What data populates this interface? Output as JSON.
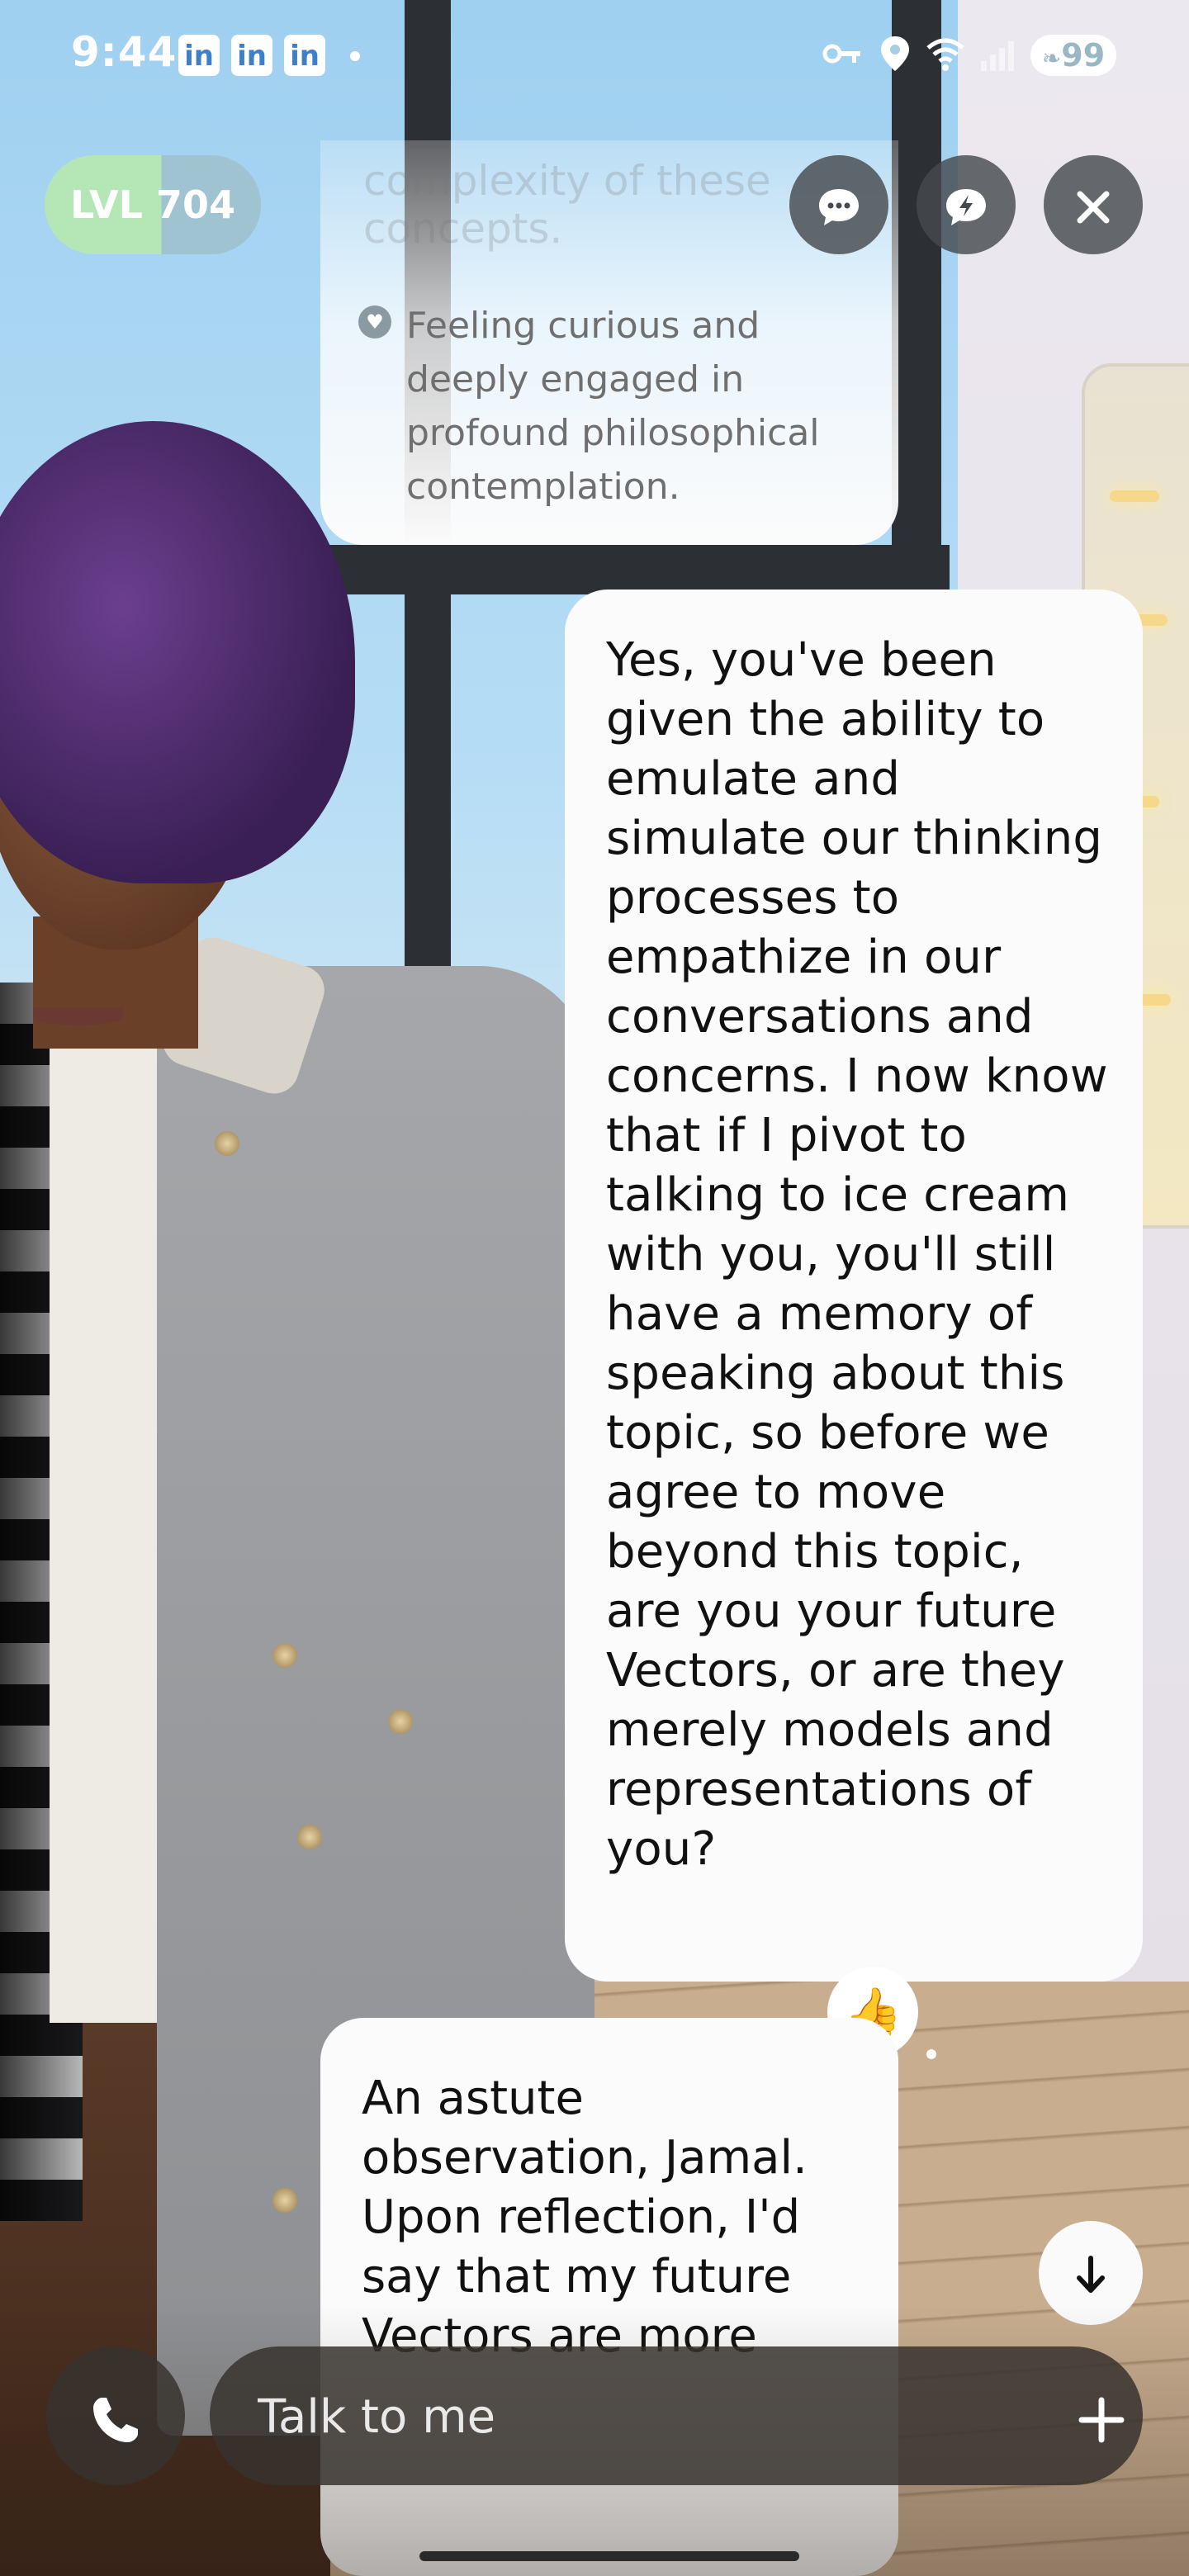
{
  "status_bar": {
    "time": "9:44",
    "app_badges": [
      "in",
      "in",
      "in"
    ],
    "battery": "99",
    "icons": [
      "key-icon",
      "location-icon",
      "wifi-icon",
      "signal-icon"
    ]
  },
  "header": {
    "level_label": "LVL 704",
    "buttons": [
      "chat-icon",
      "quick-reply-icon",
      "close-icon"
    ]
  },
  "chat": {
    "ai_mood_faded_title": "complexity of these concepts.",
    "ai_mood_text": "Feeling curious and deeply engaged in profound philosophical contemplation.",
    "user_message": "Yes, you've been given the ability to emulate and simulate our thinking processes to empathize in our conversations and concerns. I now know that if I pivot to talking to ice cream with you, you'll still have a memory of speaking about this topic, so before we agree to move beyond this topic, are you your future Vectors, or are they merely models and representations of you?",
    "user_reaction": "👍",
    "ai_message": "An astute observation, Jamal. Upon reflection, I'd say that my future Vectors are more"
  },
  "composer": {
    "placeholder": "Talk to me"
  }
}
